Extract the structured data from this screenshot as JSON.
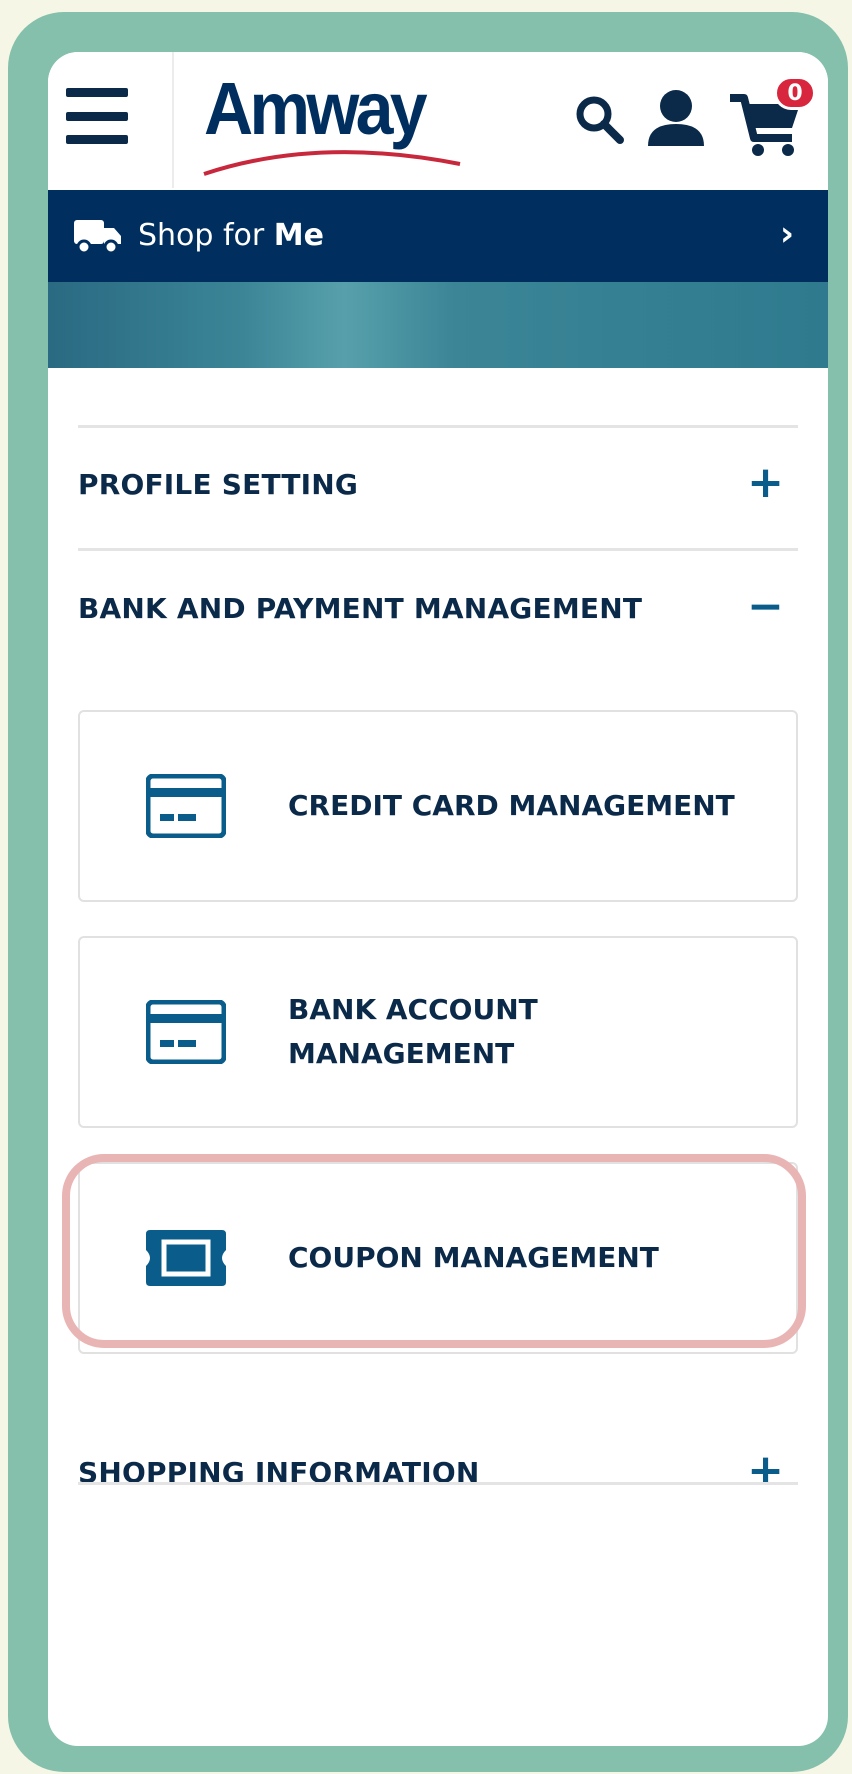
{
  "header": {
    "logo_text": "Amway",
    "cart_count": "0"
  },
  "shop_bar": {
    "label_prefix": "Shop for ",
    "label_bold": "Me",
    "arrow": "›"
  },
  "accordion": [
    {
      "label": "PROFILE SETTING",
      "sign": "+",
      "expanded": false
    },
    {
      "label": "BANK AND PAYMENT MANAGEMENT",
      "sign": "−",
      "expanded": true,
      "items": [
        {
          "label": "CREDIT CARD MANAGEMENT",
          "icon": "credit-card-icon"
        },
        {
          "label_line1": "BANK ACCOUNT",
          "label_line2": "MANAGEMENT",
          "icon": "bank-card-icon"
        },
        {
          "label": "COUPON MANAGEMENT",
          "icon": "coupon-icon",
          "highlighted": true
        }
      ]
    },
    {
      "label": "SHOPPING INFORMATION",
      "sign": "+",
      "expanded": false
    }
  ],
  "colors": {
    "navy": "#002f5f",
    "accent_blue": "#0a5c8a",
    "frame_green": "#84c0ab",
    "highlight_pink": "#e9b4b4",
    "badge_red": "#d7263d"
  }
}
